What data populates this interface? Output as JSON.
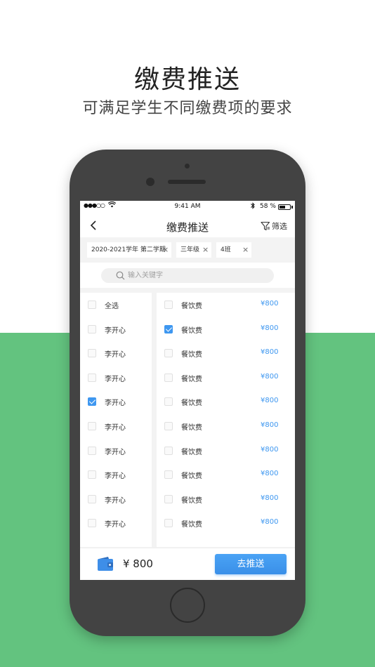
{
  "hero": {
    "title": "缴费推送",
    "subtitle": "可满足学生不同缴费项的要求"
  },
  "status_bar": {
    "signal": "●●●○○",
    "time": "9:41 AM",
    "battery_percent_text": "58 %",
    "battery_level": 0.58
  },
  "nav": {
    "title": "缴费推送",
    "filter_label": "筛选"
  },
  "tags": [
    {
      "label": "2020-2021学年 第二学期"
    },
    {
      "label": "三年级"
    },
    {
      "label": "4班"
    }
  ],
  "search": {
    "placeholder": "输入关键字"
  },
  "students": [
    {
      "label": "全选",
      "checked": false
    },
    {
      "label": "李开心",
      "checked": false
    },
    {
      "label": "李开心",
      "checked": false
    },
    {
      "label": "李开心",
      "checked": false
    },
    {
      "label": "李开心",
      "checked": true
    },
    {
      "label": "李开心",
      "checked": false
    },
    {
      "label": "李开心",
      "checked": false
    },
    {
      "label": "李开心",
      "checked": false
    },
    {
      "label": "李开心",
      "checked": false
    },
    {
      "label": "李开心",
      "checked": false
    }
  ],
  "fees": [
    {
      "label": "餐饮费",
      "price": "¥800",
      "checked": false
    },
    {
      "label": "餐饮费",
      "price": "¥800",
      "checked": true
    },
    {
      "label": "餐饮费",
      "price": "¥800",
      "checked": false
    },
    {
      "label": "餐饮费",
      "price": "¥800",
      "checked": false
    },
    {
      "label": "餐饮费",
      "price": "¥800",
      "checked": false
    },
    {
      "label": "餐饮费",
      "price": "¥800",
      "checked": false
    },
    {
      "label": "餐饮费",
      "price": "¥800",
      "checked": false
    },
    {
      "label": "餐饮费",
      "price": "¥800",
      "checked": false
    },
    {
      "label": "餐饮费",
      "price": "¥800",
      "checked": false
    },
    {
      "label": "餐饮费",
      "price": "¥800",
      "checked": false
    }
  ],
  "bottom": {
    "total": "¥ 800",
    "push_label": "去推送"
  },
  "colors": {
    "accent": "#3e97f0",
    "background_green": "#63c37f",
    "phone_body": "#434343"
  }
}
